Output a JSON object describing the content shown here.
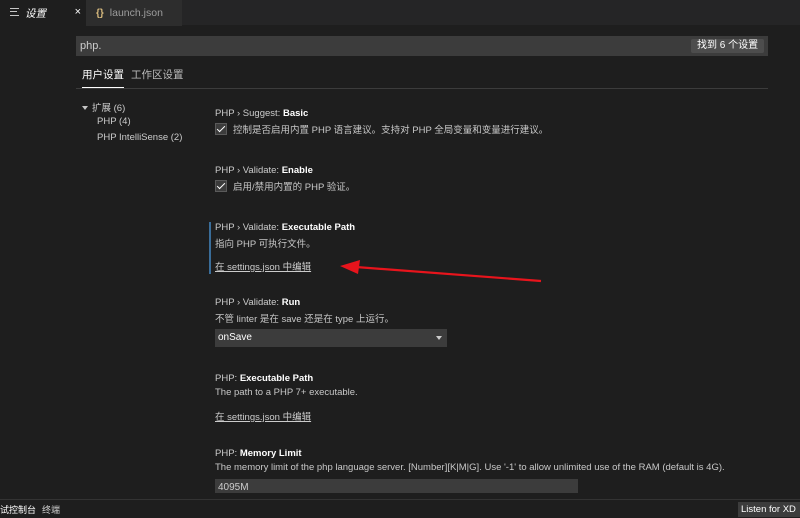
{
  "tabs": [
    {
      "label": "设置",
      "close": "×"
    },
    {
      "icon": "{}",
      "label": "launch.json"
    }
  ],
  "search": {
    "value": "php.",
    "result_badge": "找到 6 个设置"
  },
  "scope_tabs": [
    "用户设置",
    "工作区设置"
  ],
  "toc": {
    "extensions": "扩展 (6)",
    "php": "PHP (4)",
    "intellisense": "PHP IntelliSense (2)"
  },
  "settings": {
    "suggest_basic": {
      "category": "PHP › Suggest: ",
      "name": "Basic",
      "checked": true,
      "description": "控制是否启用内置 PHP 语言建议。支持对 PHP 全局变量和变量进行建议。"
    },
    "validate_enable": {
      "category": "PHP › Validate: ",
      "name": "Enable",
      "checked": true,
      "description": "启用/禁用内置的 PHP 验证。"
    },
    "validate_executable_path": {
      "category": "PHP › Validate: ",
      "name": "Executable Path",
      "description": "指向 PHP 可执行文件。",
      "link": "在 settings.json 中编辑"
    },
    "validate_run": {
      "category": "PHP › Validate: ",
      "name": "Run",
      "description": "不管 linter 是在 save 还是在 type 上运行。",
      "selected": "onSave"
    },
    "executable_path": {
      "category": "PHP: ",
      "name": "Executable Path",
      "description": "The path to a PHP 7+ executable.",
      "link": "在 settings.json 中编辑"
    },
    "memory_limit": {
      "category": "PHP: ",
      "name": "Memory Limit",
      "description": "The memory limit of the php language server. [Number][K|M|G]. Use '-1' to allow unlimited use of the RAM (default is 4G).",
      "value": "4095M"
    }
  },
  "status": {
    "debug_console": "试控制台",
    "terminal": "终端",
    "listen_button": "Listen for XD"
  },
  "colors": {
    "background": "#1e1e1e",
    "annotation_arrow": "#e8141c",
    "focus_bar": "#3a6d99"
  }
}
